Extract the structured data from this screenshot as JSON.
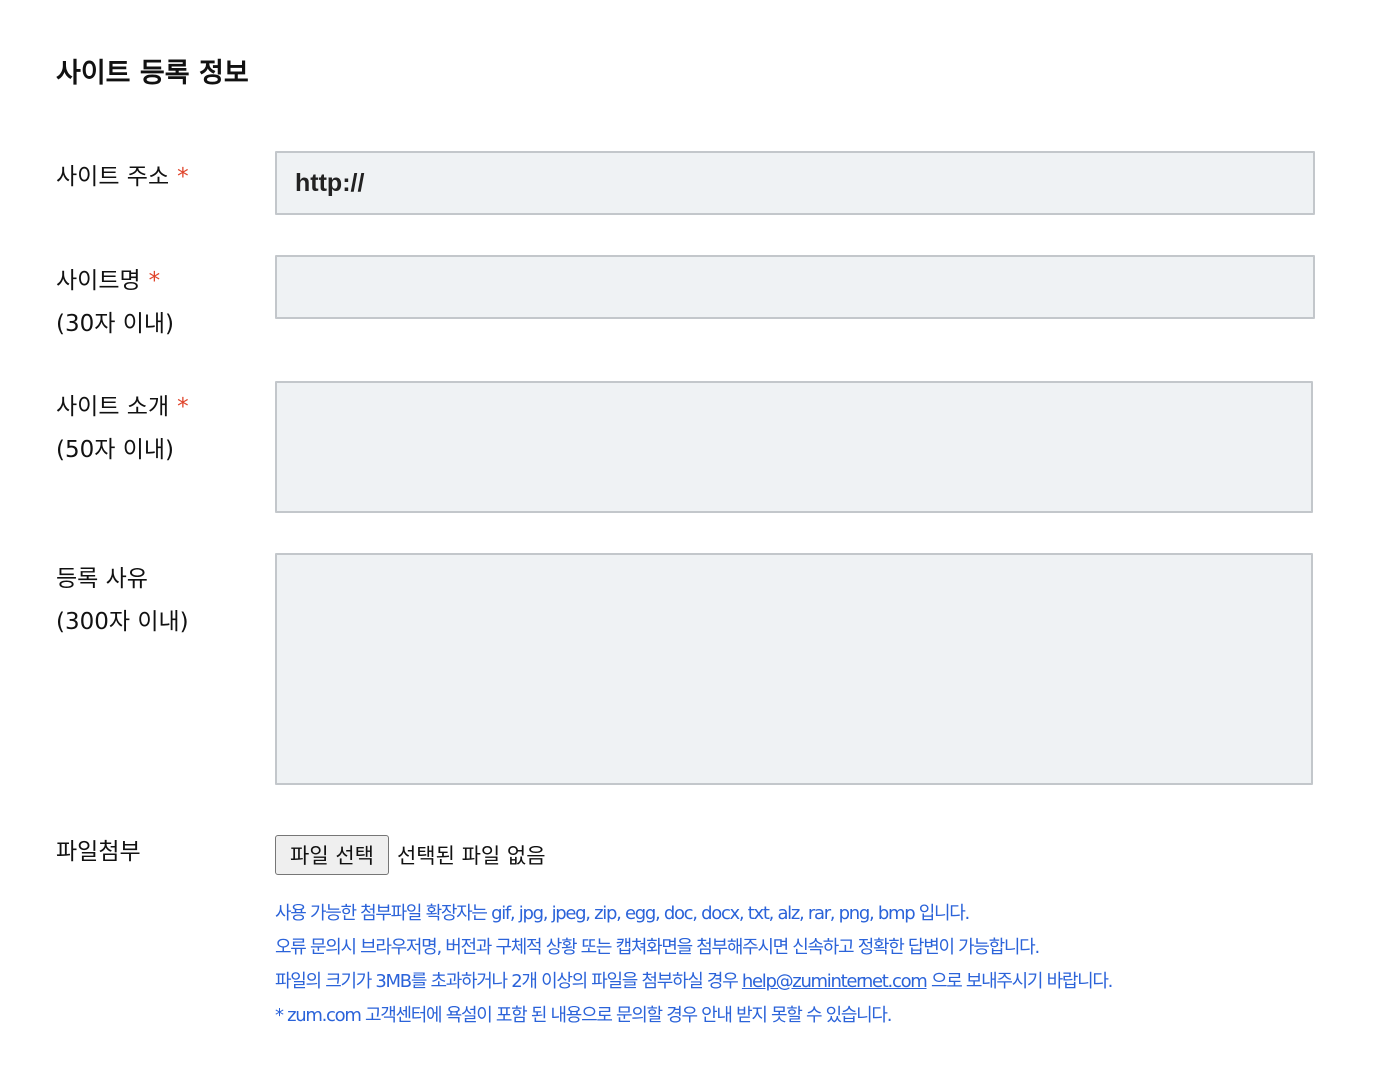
{
  "section_title": "사이트 등록 정보",
  "required_mark": "*",
  "fields": {
    "url": {
      "label": "사이트 주소",
      "value": "http://"
    },
    "name": {
      "label": "사이트명",
      "sublabel": "(30자 이내)",
      "value": ""
    },
    "intro": {
      "label": "사이트 소개",
      "sublabel": "(50자 이내)",
      "value": ""
    },
    "reason": {
      "label": "등록 사유",
      "sublabel": "(300자 이내)",
      "value": ""
    }
  },
  "attachment": {
    "label": "파일첨부",
    "button_label": "파일 선택",
    "status": "선택된 파일 없음"
  },
  "notes": {
    "line1": "사용 가능한 첨부파일 확장자는 gif, jpg, jpeg, zip, egg, doc, docx, txt, alz, rar, png, bmp 입니다.",
    "line2": "오류 문의시 브라우저명, 버전과 구체적 상황 또는 캡쳐화면을 첨부해주시면 신속하고 정확한 답변이 가능합니다.",
    "line3_before": "파일의 크기가 3MB를 초과하거나 2개 이상의 파일을 첨부하실 경우 ",
    "line3_email": "help@zuminternet.com",
    "line3_after": " 으로 보내주시기 바랍니다.",
    "line4": " * zum.com 고객센터에 욕설이 포함 된 내용으로 문의할 경우 안내 받지 못할 수 있습니다."
  },
  "colors": {
    "required": "#e0442b",
    "notes_text": "#2b63d9",
    "field_background": "#eff2f4",
    "field_border": "#c3c7cb"
  }
}
